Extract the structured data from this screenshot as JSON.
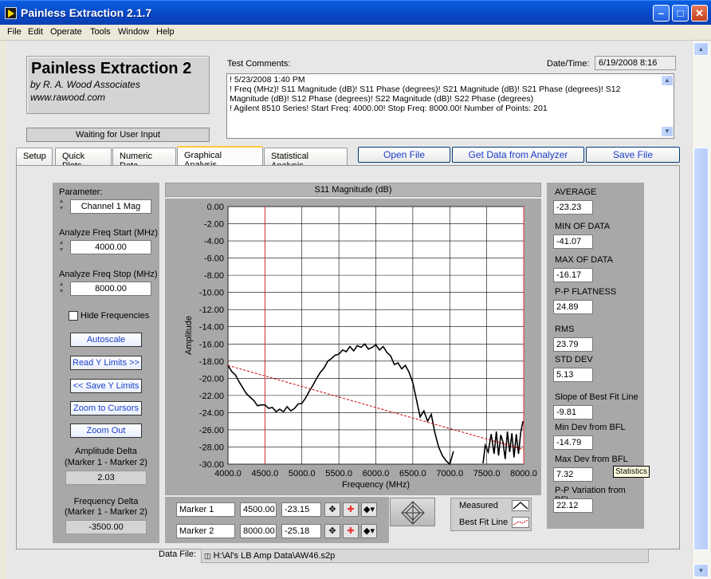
{
  "window": {
    "title": "Painless Extraction 2.1.7",
    "controls": [
      "minimize",
      "maximize",
      "close"
    ]
  },
  "menu": [
    "File",
    "Edit",
    "Operate",
    "Tools",
    "Window",
    "Help"
  ],
  "logo": {
    "title": "Painless Extraction 2",
    "line1": "by R. A. Wood Associates",
    "line2": "www.rawood.com"
  },
  "status": "Waiting for User Input",
  "comments": {
    "label": "Test Comments:",
    "text": "! 5/23/2008 1:40 PM\n! Freq (MHz)! S11 Magnitude (dB)! S11 Phase (degrees)! S21 Magnitude (dB)! S21 Phase (degrees)! S12 Magnitude (dB)! S12 Phase (degrees)! S22 Magnitude (dB)! S22 Phase (degrees)\n! Agilent 8510 Series! Start Freq: 4000.00! Stop Freq: 8000.00! Number of Points: 201"
  },
  "date": {
    "label": "Date/Time:",
    "value": "6/19/2008  8:16"
  },
  "tabs": [
    {
      "label": "Setup",
      "active": false
    },
    {
      "label": "Quick Plots",
      "active": false
    },
    {
      "label": "Numeric Data",
      "active": false
    },
    {
      "label": "Graphical Analysis",
      "active": true
    },
    {
      "label": "Statistical Analysis",
      "active": false
    }
  ],
  "toolbar": {
    "open_file": "Open File",
    "get_data": "Get Data from Analyzer",
    "save_file": "Save File"
  },
  "left_panel": {
    "parameter_label": "Parameter:",
    "parameter_value": "Channel 1 Mag",
    "start_label": "Analyze Freq Start (MHz)",
    "start_value": "4000.00",
    "stop_label": "Analyze Freq Stop (MHz)",
    "stop_value": "8000.00",
    "hide_freq_label": "Hide Frequencies",
    "hide_freq_checked": false,
    "autoscale": "Autoscale",
    "read_y": "Read Y Limits >>",
    "save_y": "<< Save Y Limits",
    "zoom_cursors": "Zoom to Cursors",
    "zoom_out": "Zoom Out",
    "amp_delta_label1": "Amplitude Delta",
    "amp_delta_label2": "(Marker 1 - Marker 2)",
    "amp_delta_value": "2.03",
    "freq_delta_label1": "Frequency Delta",
    "freq_delta_label2": "(Marker 1 - Marker 2)",
    "freq_delta_value": "-3500.00"
  },
  "chart_data": {
    "type": "line",
    "title": "S11 Magnitude (dB)",
    "xlabel": "Frequency (MHz)",
    "ylabel": "Amplitude",
    "xlim": [
      4000,
      8000
    ],
    "ylim": [
      -30,
      0
    ],
    "x_ticks": [
      "4000.0",
      "4500.0",
      "5000.0",
      "5500.0",
      "6000.0",
      "6500.0",
      "7000.0",
      "7500.0",
      "8000.0"
    ],
    "y_ticks": [
      "0.00",
      "-2.00",
      "-4.00",
      "-6.00",
      "-8.00",
      "-10.00",
      "-12.00",
      "-14.00",
      "-16.00",
      "-18.00",
      "-20.00",
      "-22.00",
      "-24.00",
      "-26.00",
      "-28.00",
      "-30.00"
    ],
    "grid": true,
    "markers": [
      4500,
      8000
    ],
    "series": [
      {
        "name": "Measured",
        "color": "#000000",
        "x": [
          4000,
          4050,
          4100,
          4150,
          4200,
          4250,
          4300,
          4350,
          4400,
          4450,
          4500,
          4550,
          4600,
          4650,
          4700,
          4750,
          4800,
          4850,
          4900,
          4950,
          5000,
          5050,
          5100,
          5150,
          5200,
          5250,
          5300,
          5350,
          5400,
          5450,
          5500,
          5550,
          5600,
          5650,
          5700,
          5750,
          5800,
          5850,
          5900,
          5950,
          6000,
          6050,
          6100,
          6150,
          6200,
          6250,
          6300,
          6350,
          6400,
          6450,
          6500,
          6550,
          6600,
          6650,
          6700,
          6750,
          6800,
          6850,
          6900,
          6950,
          7000,
          7050
        ],
        "y": [
          -18.5,
          -19.2,
          -19.6,
          -20.4,
          -21.1,
          -21.8,
          -22.2,
          -22.6,
          -23.2,
          -23.1,
          -23.1,
          -23.5,
          -23.4,
          -23.9,
          -23.6,
          -23.9,
          -23.3,
          -23.8,
          -23.5,
          -23.0,
          -22.9,
          -22.3,
          -21.5,
          -20.8,
          -20.0,
          -19.3,
          -18.8,
          -18.0,
          -17.7,
          -17.3,
          -17.2,
          -16.7,
          -16.9,
          -16.3,
          -16.8,
          -16.2,
          -16.4,
          -16.0,
          -16.6,
          -16.4,
          -16.1,
          -16.7,
          -16.3,
          -17.0,
          -17.4,
          -18.4,
          -18.2,
          -18.9,
          -18.5,
          -19.3,
          -20.5,
          -22.5,
          -24.5,
          -23.8,
          -25.0,
          -24.2,
          -26.4,
          -28.0,
          -29.0,
          -29.6,
          -30.0,
          -28.5
        ]
      },
      {
        "name": "Measured (tail)",
        "color": "#000000",
        "x": [
          7450,
          7480,
          7520,
          7560,
          7600,
          7630,
          7660,
          7690,
          7720,
          7750,
          7780,
          7810,
          7840,
          7870,
          7900,
          7930,
          7960,
          7990
        ],
        "y": [
          -29.9,
          -27.8,
          -28.6,
          -26.5,
          -28.8,
          -26.2,
          -29.0,
          -26.6,
          -27.4,
          -29.4,
          -26.2,
          -28.6,
          -26.4,
          -29.2,
          -26.5,
          -28.8,
          -26.3,
          -25.0
        ]
      },
      {
        "name": "Best Fit Line",
        "color": "#cc0000",
        "x": [
          4000,
          8000
        ],
        "y": [
          -18.5,
          -28.3
        ]
      }
    ]
  },
  "stats": [
    {
      "label": "AVERAGE",
      "value": "-23.23"
    },
    {
      "label": "MIN OF DATA",
      "value": "-41.07"
    },
    {
      "label": "MAX OF DATA",
      "value": "-16.17"
    },
    {
      "label": "P-P FLATNESS",
      "value": "24.89"
    },
    {
      "label": "RMS",
      "value": "23.79"
    },
    {
      "label": "STD DEV",
      "value": "5.13"
    },
    {
      "label": "Slope of Best Fit Line",
      "value": "-9.81"
    },
    {
      "label": "Min Dev from BFL",
      "value": "-14.79"
    },
    {
      "label": "Max Dev from BFL",
      "value": "7.32"
    },
    {
      "label": "P-P Variation from BFL",
      "value": "22.12"
    }
  ],
  "tooltip": "Statistics",
  "markers": [
    {
      "name": "Marker 1",
      "freq": "4500.00",
      "amp": "-23.15"
    },
    {
      "name": "Marker 2",
      "freq": "8000.00",
      "amp": "-25.18"
    }
  ],
  "legend": {
    "measured": "Measured",
    "bestfit": "Best Fit Line"
  },
  "datafile": {
    "label": "Data File:",
    "value": "H:\\Al's LB Amp Data\\AW46.s2p"
  }
}
